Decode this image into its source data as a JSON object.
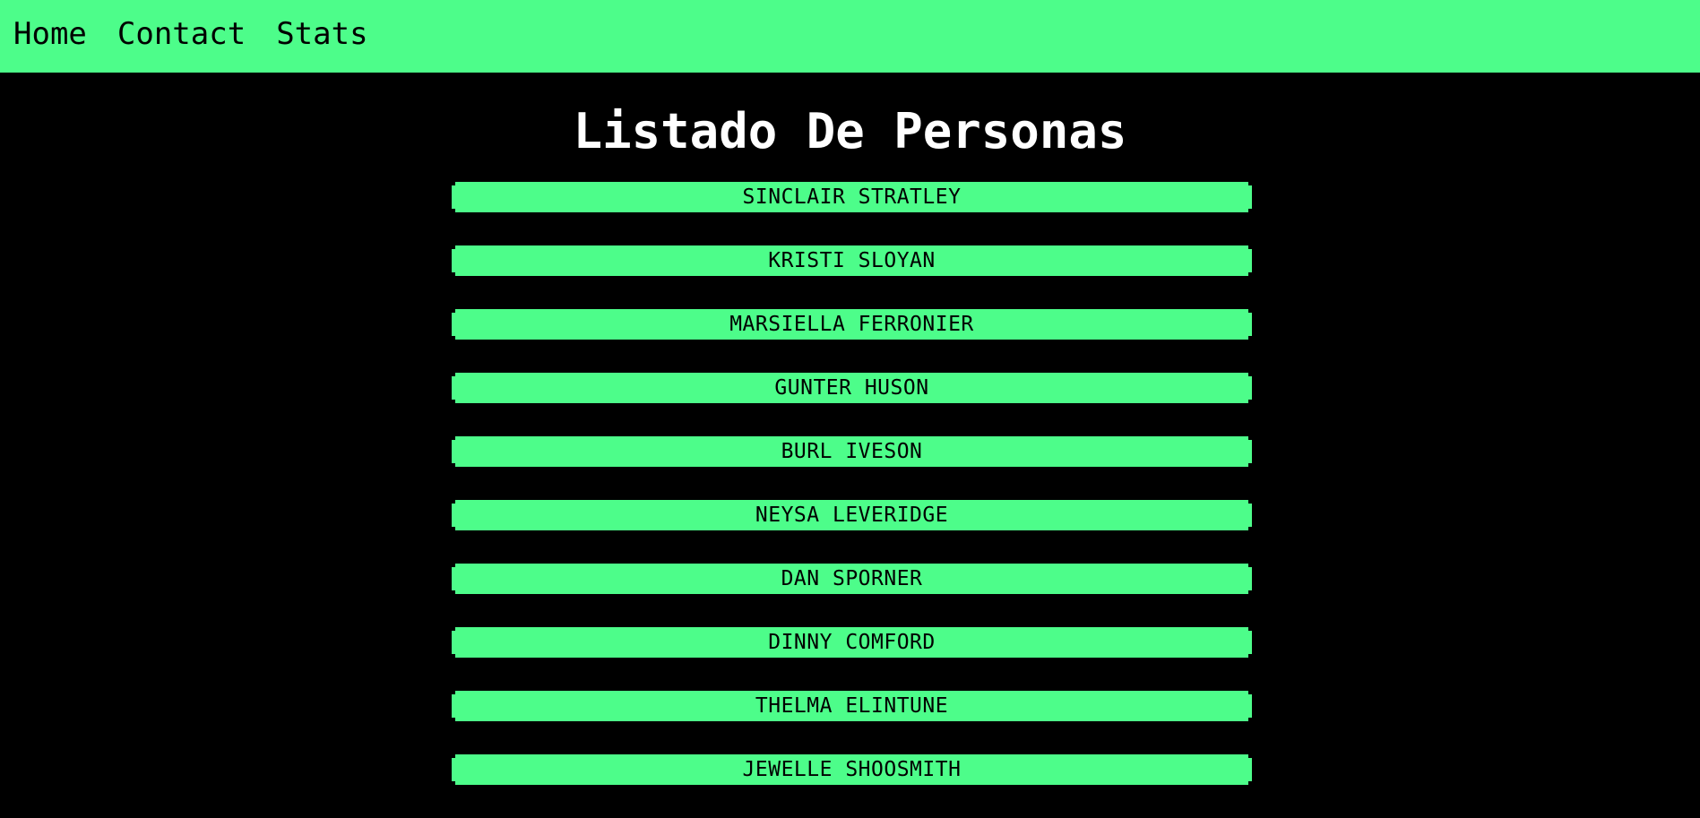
{
  "nav": {
    "links": [
      "Home",
      "Contact",
      "Stats"
    ]
  },
  "page": {
    "title": "Listado De Personas"
  },
  "people": [
    "SINCLAIR STRATLEY",
    "KRISTI SLOYAN",
    "MARSIELLA FERRONIER",
    "GUNTER HUSON",
    "BURL IVESON",
    "NEYSA LEVERIDGE",
    "DAN SPORNER",
    "DINNY COMFORD",
    "THELMA ELINTUNE",
    "JEWELLE SHOOSMITH"
  ],
  "colors": {
    "accent": "#4dfd8a",
    "background": "#000000",
    "title": "#ffffff"
  }
}
